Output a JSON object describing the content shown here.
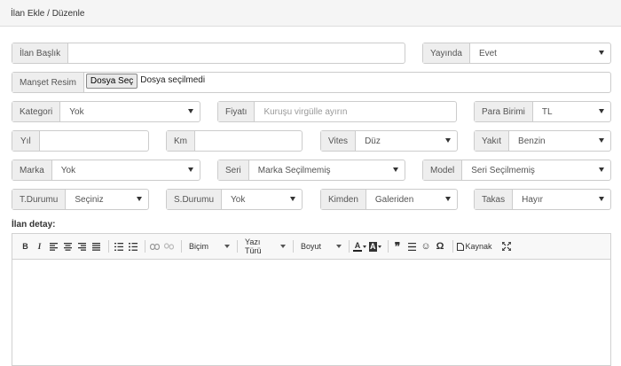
{
  "panel": {
    "title": "İlan Ekle / Düzenle"
  },
  "fields": {
    "ilan_baslik": {
      "label": "İlan Başlık",
      "value": ""
    },
    "yayinda": {
      "label": "Yayında",
      "value": "Evet"
    },
    "manset_resim": {
      "label": "Manşet Resim",
      "button": "Dosya Seç",
      "status": "Dosya seçilmedi"
    },
    "kategori": {
      "label": "Kategori",
      "value": "Yok"
    },
    "fiyat": {
      "label": "Fiyatı",
      "placeholder": "Kuruşu virgülle ayırın"
    },
    "para_birimi": {
      "label": "Para Birimi",
      "value": "TL"
    },
    "yil": {
      "label": "Yıl",
      "value": ""
    },
    "km": {
      "label": "Km",
      "value": ""
    },
    "vites": {
      "label": "Vites",
      "value": "Düz"
    },
    "yakit": {
      "label": "Yakıt",
      "value": "Benzin"
    },
    "marka": {
      "label": "Marka",
      "value": "Yok"
    },
    "seri": {
      "label": "Seri",
      "value": "Marka Seçilmemiş"
    },
    "model": {
      "label": "Model",
      "value": "Seri Seçilmemiş"
    },
    "t_durumu": {
      "label": "T.Durumu",
      "value": "Seçiniz"
    },
    "s_durumu": {
      "label": "S.Durumu",
      "value": "Yok"
    },
    "kimden": {
      "label": "Kimden",
      "value": "Galeriden"
    },
    "takas": {
      "label": "Takas",
      "value": "Hayır"
    }
  },
  "editor": {
    "label": "İlan detay:",
    "toolbar": {
      "bold": "B",
      "italic": "I",
      "format": "Biçim",
      "font": "Yazı Türü",
      "size": "Boyut",
      "text_color": "A",
      "bg_color": "A",
      "quote": "❞",
      "smiley": "☺",
      "omega": "Ω",
      "source": "Kaynak"
    }
  },
  "icons": [
    "align-left-icon",
    "align-center-icon",
    "align-right-icon",
    "justify-icon",
    "numbered-list-icon",
    "bulleted-list-icon",
    "link-icon",
    "unlink-icon",
    "horizontal-rule-icon",
    "source-icon",
    "maximize-icon"
  ]
}
